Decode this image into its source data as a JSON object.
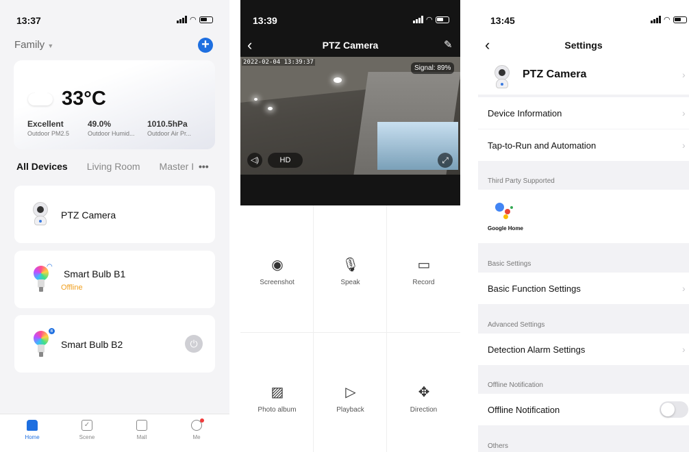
{
  "home": {
    "time": "13:37",
    "family": "Family",
    "weather": {
      "temperature": "33°C",
      "stats": [
        {
          "value": "Excellent",
          "label": "Outdoor PM2.5"
        },
        {
          "value": "49.0%",
          "label": "Outdoor Humid..."
        },
        {
          "value": "1010.5hPa",
          "label": "Outdoor Air Pr..."
        }
      ]
    },
    "tabs": [
      "All Devices",
      "Living Room",
      "Master I"
    ],
    "more": "•••",
    "devices": [
      {
        "name": "PTZ Camera",
        "status": ""
      },
      {
        "name": "Smart Bulb B1",
        "status": "Offline"
      },
      {
        "name": "Smart Bulb B2",
        "status": ""
      }
    ],
    "nav": [
      "Home",
      "Scene",
      "Mall",
      "Me"
    ]
  },
  "camera": {
    "time": "13:39",
    "title": "PTZ Camera",
    "timestamp": "2022-02-04 13:39:37",
    "signal": "Signal: 89%",
    "quality": "HD",
    "actions": [
      "Screenshot",
      "Speak",
      "Record",
      "Photo album",
      "Playback",
      "Direction"
    ]
  },
  "settings": {
    "time": "13:45",
    "title": "Settings",
    "device_name": "PTZ Camera",
    "rows": {
      "device_info": "Device Information",
      "tap_to_run": "Tap-to-Run and Automation",
      "basic_function": "Basic Function Settings",
      "detection_alarm": "Detection Alarm Settings",
      "offline_notification": "Offline Notification"
    },
    "sections": {
      "third_party": "Third Party Supported",
      "basic": "Basic Settings",
      "advanced": "Advanced Settings",
      "offline": "Offline Notification",
      "others": "Others"
    },
    "google_home": "Google Home",
    "offline_toggle_on": false
  }
}
